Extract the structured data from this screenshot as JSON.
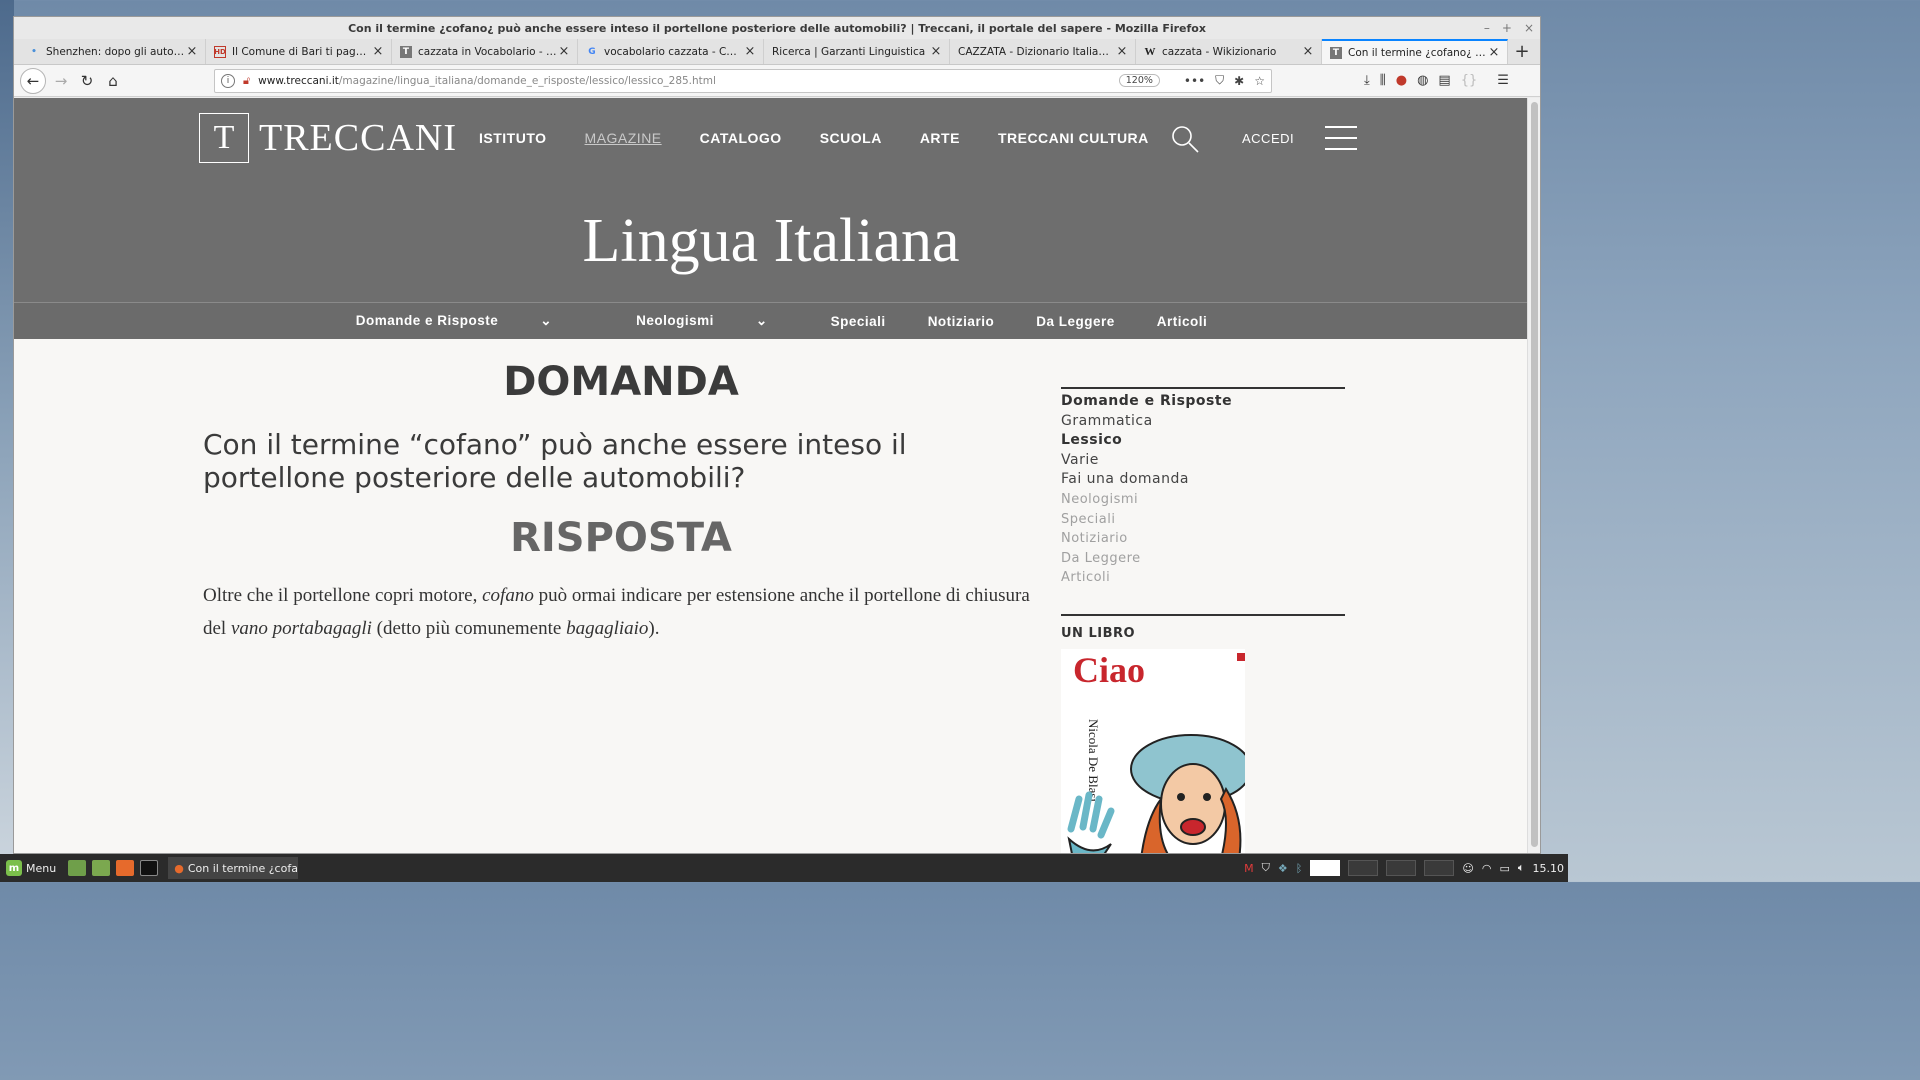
{
  "window": {
    "title": "Con il termine ¿cofano¿ può anche essere inteso il portellone posteriore delle automobili? | Treccani, il portale del sapere - Mozilla Firefox",
    "controls": [
      "–",
      "+",
      "×"
    ]
  },
  "tabs": [
    {
      "label": "Shenzhen: dopo gli autobus, c",
      "favicon": "dot-icon"
    },
    {
      "label": "Il Comune di Bari ti paga se ti",
      "favicon": "hd-icon"
    },
    {
      "label": "cazzata in Vocabolario - Trec",
      "favicon": "treccani-icon"
    },
    {
      "label": "vocabolario cazzata - Cerca c",
      "favicon": "google-icon"
    },
    {
      "label": "Ricerca | Garzanti Linguistica",
      "favicon": ""
    },
    {
      "label": "CAZZATA - Dizionario Italiano onl",
      "favicon": ""
    },
    {
      "label": "cazzata - Wikizionario",
      "favicon": "wikipedia-icon"
    },
    {
      "label": "Con il termine ¿cofano¿ può a",
      "favicon": "treccani-icon",
      "active": true
    }
  ],
  "navbar": {
    "url_domain": "www.treccani.it",
    "url_path": "/magazine/lingua_italiana/domande_e_risposte/lessico/lessico_285.html",
    "zoom": "120%",
    "more_label": "•••"
  },
  "site": {
    "logo_letter": "T",
    "logo_text": "TRECCANI",
    "nav": [
      "ISTITUTO",
      "MAGAZINE",
      "CATALOGO",
      "SCUOLA",
      "ARTE",
      "TRECCANI CULTURA"
    ],
    "accedi": "ACCEDI",
    "section_title": "Lingua Italiana",
    "subnav": [
      "Domande e Risposte",
      "Neologismi",
      "Speciali",
      "Notiziario",
      "Da Leggere",
      "Articoli"
    ]
  },
  "article": {
    "domanda_heading": "DOMANDA",
    "question": "Con il termine “cofano” può anche essere inteso il portellone posteriore delle automobili?",
    "risposta_heading": "RISPOSTA",
    "answer": {
      "p1": "Oltre che il portellone copri motore, ",
      "e1": "cofano",
      "p2": " può ormai indicare per estensione anche il portellone di chiusura del ",
      "e2": "vano portabagagli",
      "p3": " (detto più comunemente ",
      "e3": "bagagliaio",
      "p4": ")."
    }
  },
  "sidebar": {
    "items": [
      {
        "label": "Domande e Risposte",
        "style": "bold"
      },
      {
        "label": "Grammatica",
        "style": "normal"
      },
      {
        "label": "Lessico",
        "style": "bold"
      },
      {
        "label": "Varie",
        "style": "normal"
      },
      {
        "label": "Fai una domanda",
        "style": "normal"
      },
      {
        "label": "Neologismi",
        "style": "muted"
      },
      {
        "label": "Speciali",
        "style": "muted"
      },
      {
        "label": "Notiziario",
        "style": "muted"
      },
      {
        "label": "Da Leggere",
        "style": "muted"
      },
      {
        "label": "Articoli",
        "style": "muted"
      }
    ],
    "book_heading": "UN LIBRO",
    "book_title": "Ciao",
    "book_author": "Nicola De Blasi"
  },
  "taskbar": {
    "menu_label": "Menu",
    "task_label": "Con il termine ¿cofa...",
    "clock": "15.10"
  },
  "colors": {
    "hero_bg": "#6e6e6e",
    "accent_tab": "#0a84ff",
    "book_red": "#c8262d"
  }
}
